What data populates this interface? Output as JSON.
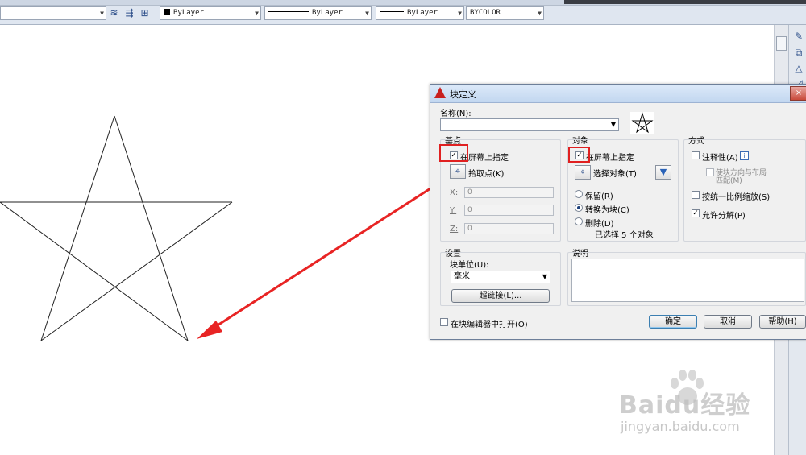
{
  "toolbar": {
    "color_combo": "ByLayer",
    "linetype_combo": "ByLayer",
    "lineweight_combo": "ByLayer",
    "plotstyle_combo": "BYCOLOR"
  },
  "dialog": {
    "title": "块定义",
    "close": "×",
    "name_label": "名称(N):",
    "name_value": "",
    "base_point": {
      "heading": "基点",
      "specify_on_screen": "在屏幕上指定",
      "pick_point": "拾取点(K)",
      "x_label": "X:",
      "x_value": "0",
      "y_label": "Y:",
      "y_value": "0",
      "z_label": "Z:",
      "z_value": "0"
    },
    "objects": {
      "heading": "对象",
      "specify_on_screen": "在屏幕上指定",
      "select_objects": "选择对象(T)",
      "retain": "保留(R)",
      "convert_to_block": "转换为块(C)",
      "delete": "删除(D)",
      "selected_count": "已选择 5 个对象"
    },
    "behavior": {
      "heading": "方式",
      "annotative": "注释性(A)",
      "match_orientation": "使块方向与布局",
      "match_orientation_2": "匹配(M)",
      "scale_uniformly": "按统一比例缩放(S)",
      "allow_exploding": "允许分解(P)"
    },
    "settings": {
      "heading": "设置",
      "block_unit_label": "块单位(U):",
      "block_unit_value": "毫米",
      "hyperlink": "超链接(L)..."
    },
    "description": {
      "heading": "说明"
    },
    "open_in_editor": "在块编辑器中打开(O)",
    "ok": "确定",
    "cancel": "取消",
    "help": "帮助(H)"
  },
  "watermark": {
    "brand": "Baidu经验",
    "url": "jingyan.baidu.com"
  }
}
